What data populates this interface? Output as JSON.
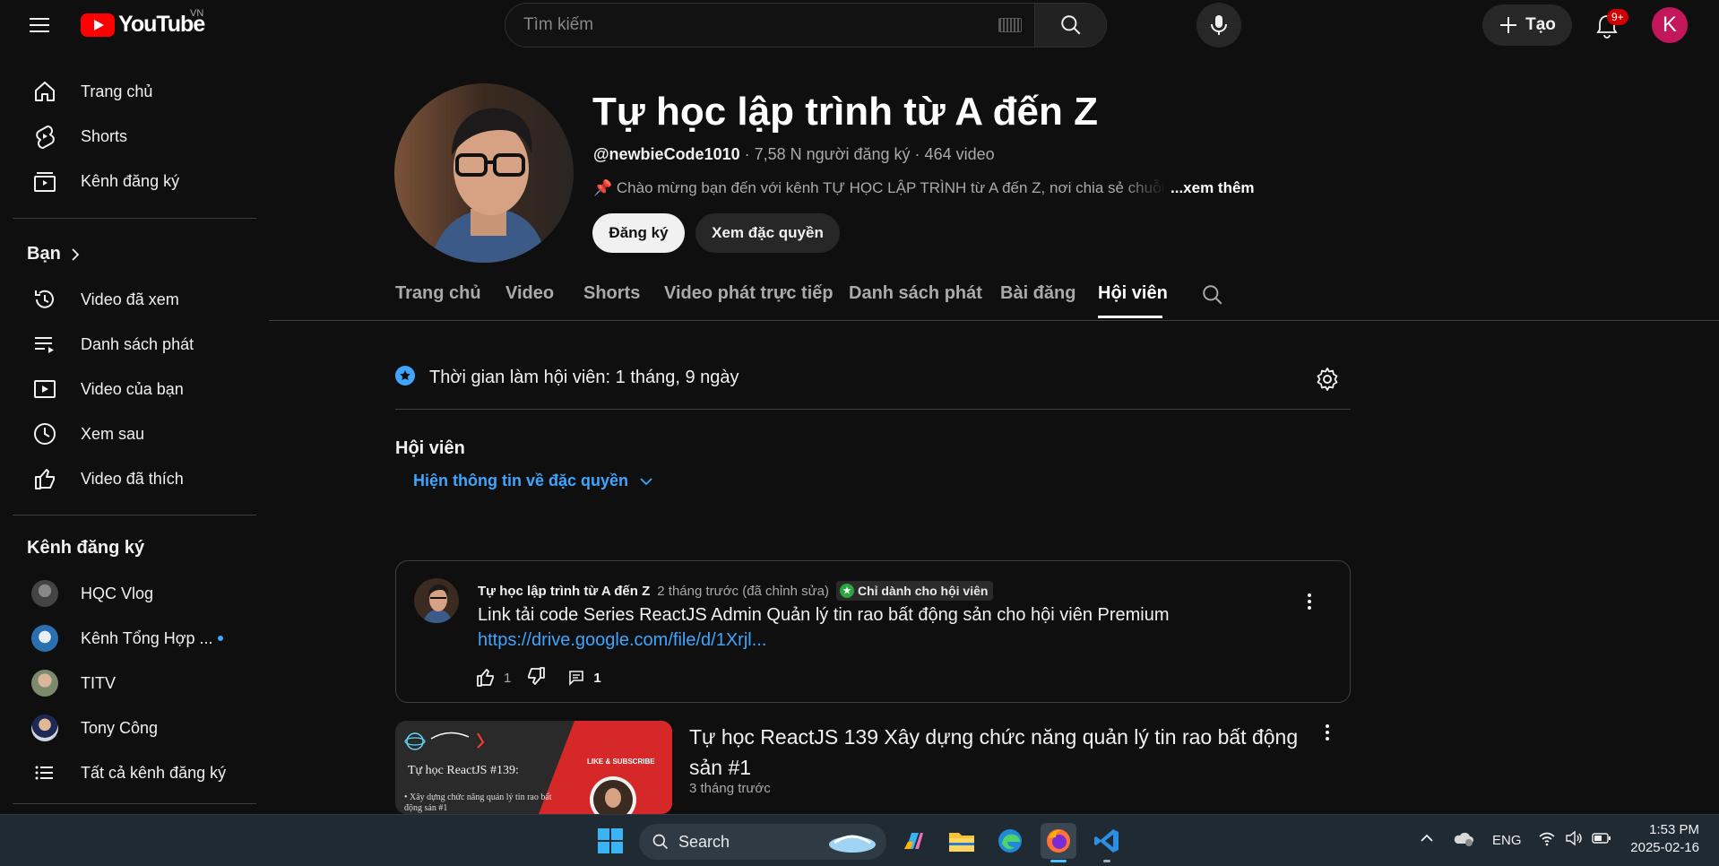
{
  "topbar": {
    "logo_text": "YouTube",
    "logo_region": "VN",
    "search_placeholder": "Tìm kiếm",
    "create_label": "Tạo",
    "notif_badge": "9+",
    "avatar_letter": "K"
  },
  "sidebar": {
    "main": [
      {
        "label": "Trang chủ",
        "icon": "home-icon"
      },
      {
        "label": "Shorts",
        "icon": "shorts-icon"
      },
      {
        "label": "Kênh đăng ký",
        "icon": "subscriptions-icon"
      }
    ],
    "you_heading": "Bạn",
    "you_items": [
      {
        "label": "Video đã xem",
        "icon": "history-icon"
      },
      {
        "label": "Danh sách phát",
        "icon": "playlist-icon"
      },
      {
        "label": "Video của bạn",
        "icon": "your-videos-icon"
      },
      {
        "label": "Xem sau",
        "icon": "watch-later-icon"
      },
      {
        "label": "Video đã thích",
        "icon": "like-icon"
      }
    ],
    "subs_heading": "Kênh đăng ký",
    "subs": [
      {
        "label": "HQC Vlog",
        "color": "#5a5a5a"
      },
      {
        "label": "Kênh Tổng Hợp ...",
        "color": "#2a6fb0"
      },
      {
        "label": "TITV",
        "color": "#7a8a6a"
      },
      {
        "label": "Tony Công",
        "color": "#cfd6e4"
      }
    ],
    "all_subs": "Tất cả kênh đăng ký"
  },
  "channel": {
    "title": "Tự học lập trình từ A đến Z",
    "handle": "@newbieCode1010",
    "stats": " · 7,58 N người đăng ký · 464 video",
    "description": "📌 Chào mừng bạn đến với kênh TỰ HỌC LẬP TRÌNH từ A đến Z, nơi chia sẻ chuỗi video",
    "more": "...xem thêm",
    "subscribe_label": "Đăng ký",
    "perks_label": "Xem đặc quyền"
  },
  "tabs": [
    "Trang chủ",
    "Video",
    "Shorts",
    "Video phát trực tiếp",
    "Danh sách phát",
    "Bài đăng",
    "Hội viên"
  ],
  "active_tab": "Hội viên",
  "membership": {
    "duration": "Thời gian làm hội viên: 1 tháng, 9 ngày",
    "heading": "Hội viên",
    "perks_link": "Hiện thông tin về đặc quyền"
  },
  "post": {
    "author": "Tự học lập trình từ A đến Z",
    "time": "2 tháng trước (đã chỉnh sửa)",
    "badge": "Chỉ dành cho hội viên",
    "body": "Link tải code Series ReactJS Admin Quản lý tin rao bất động sản cho hội viên Premium",
    "link": "https://drive.google.com/file/d/1Xrjl...",
    "likes": "1",
    "comments": "1"
  },
  "video": {
    "title": "Tự học ReactJS 139 Xây dựng chức năng quản lý tin rao bất động sản #1",
    "time": "3 tháng trước",
    "thumb_title": "Tự học ReactJS #139:",
    "thumb_bullet": "• Xây dựng chức năng quản lý tin rao bất động sản #1",
    "thumb_cta": "LIKE & SUBSCRIBE"
  },
  "taskbar": {
    "search_label": "Search",
    "lang": "ENG",
    "time": "1:53 PM",
    "date": "2025-02-16"
  }
}
